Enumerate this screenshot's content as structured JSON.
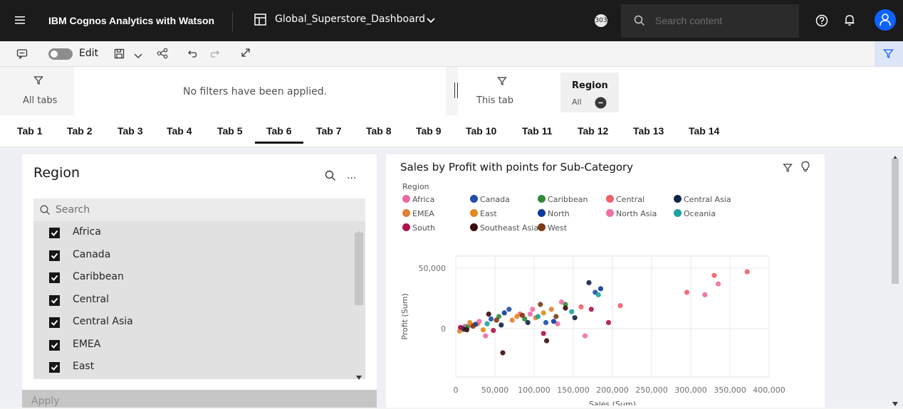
{
  "app": {
    "title": "IBM Cognos Analytics with Watson",
    "dashboard_name": "Global_Superstore_Dashboard",
    "notification_badge": "303",
    "search_placeholder": "Search content"
  },
  "toolbar": {
    "edit_label": "Edit"
  },
  "filters": {
    "all_tabs_label": "All tabs",
    "no_filters_text": "No filters have been applied.",
    "this_tab_label": "This tab",
    "region_chip": {
      "title": "Region",
      "value": "All"
    }
  },
  "tabs": [
    "Tab 1",
    "Tab 2",
    "Tab 3",
    "Tab 4",
    "Tab 5",
    "Tab 6",
    "Tab 7",
    "Tab 8",
    "Tab 9",
    "Tab 10",
    "Tab 11",
    "Tab 12",
    "Tab 13",
    "Tab 14"
  ],
  "active_tab": "Tab 6",
  "region_panel": {
    "title": "Region",
    "search_placeholder": "Search",
    "items": [
      {
        "label": "Africa",
        "checked": true
      },
      {
        "label": "Canada",
        "checked": true
      },
      {
        "label": "Caribbean",
        "checked": true
      },
      {
        "label": "Central",
        "checked": true
      },
      {
        "label": "Central Asia",
        "checked": true
      },
      {
        "label": "EMEA",
        "checked": true
      },
      {
        "label": "East",
        "checked": true
      }
    ],
    "apply_label": "Apply"
  },
  "chart_data": {
    "type": "scatter",
    "title": "Sales by Profit with points for Sub-Category",
    "xlabel": "Sales (Sum)",
    "ylabel": "Profit (Sum)",
    "legend_title": "Region",
    "xlim": [
      0,
      400000
    ],
    "ylim": [
      -40000,
      60000
    ],
    "xticks": [
      "0",
      "50,000",
      "100,000",
      "150,000",
      "200,000",
      "250,000",
      "300,000",
      "350,000",
      "400,000"
    ],
    "yticks": [
      "0",
      "50,000"
    ],
    "grid": true,
    "series": [
      {
        "name": "Africa",
        "color": "#e96aa4",
        "points": [
          [
            12000,
            2000
          ],
          [
            38000,
            -6000
          ],
          [
            95000,
            12000
          ],
          [
            130000,
            4000
          ],
          [
            318000,
            28000
          ]
        ]
      },
      {
        "name": "Canada",
        "color": "#1f4fa6",
        "points": [
          [
            8000,
            500
          ],
          [
            45000,
            8000
          ],
          [
            68000,
            16000
          ],
          [
            115000,
            5000
          ],
          [
            178000,
            30000
          ]
        ]
      },
      {
        "name": "Caribbean",
        "color": "#2e8b3a",
        "points": [
          [
            15000,
            1500
          ],
          [
            55000,
            10000
          ],
          [
            88000,
            8000
          ],
          [
            140000,
            20000
          ]
        ]
      },
      {
        "name": "Central",
        "color": "#ee5f6b",
        "points": [
          [
            20000,
            3000
          ],
          [
            82000,
            12000
          ],
          [
            160000,
            18000
          ],
          [
            210000,
            19000
          ],
          [
            295000,
            30000
          ],
          [
            330000,
            44000
          ],
          [
            372000,
            47000
          ]
        ]
      },
      {
        "name": "Central Asia",
        "color": "#0f2546",
        "points": [
          [
            10000,
            -500
          ],
          [
            58000,
            3000
          ],
          [
            92000,
            5000
          ],
          [
            152000,
            9000
          ],
          [
            170000,
            38000
          ]
        ]
      },
      {
        "name": "EMEA",
        "color": "#e08034",
        "points": [
          [
            5000,
            -2000
          ],
          [
            28000,
            4000
          ],
          [
            72000,
            7000
          ],
          [
            102000,
            9000
          ],
          [
            122000,
            16000
          ]
        ]
      },
      {
        "name": "East",
        "color": "#e08a1e",
        "points": [
          [
            18000,
            5000
          ],
          [
            35000,
            -1000
          ],
          [
            78000,
            10000
          ],
          [
            112000,
            13000
          ]
        ]
      },
      {
        "name": "North",
        "color": "#0c3aa0",
        "points": [
          [
            25000,
            3500
          ],
          [
            62000,
            13000
          ],
          [
            125000,
            6000
          ],
          [
            185000,
            33000
          ]
        ]
      },
      {
        "name": "North Asia",
        "color": "#ee6fa2",
        "points": [
          [
            30000,
            6000
          ],
          [
            98000,
            16000
          ],
          [
            135000,
            22000
          ],
          [
            165000,
            -6000
          ],
          [
            335000,
            37000
          ]
        ]
      },
      {
        "name": "Oceania",
        "color": "#1aa3a0",
        "points": [
          [
            40000,
            4000
          ],
          [
            105000,
            10000
          ],
          [
            148000,
            14000
          ],
          [
            182000,
            28000
          ]
        ]
      },
      {
        "name": "South",
        "color": "#b0124e",
        "points": [
          [
            6000,
            1000
          ],
          [
            48000,
            -1500
          ],
          [
            112000,
            -4000
          ],
          [
            173000,
            16000
          ],
          [
            195000,
            5000
          ]
        ]
      },
      {
        "name": "Southeast Asia",
        "color": "#3a0a0a",
        "points": [
          [
            14000,
            -1000
          ],
          [
            42000,
            12000
          ],
          [
            60000,
            -20000
          ],
          [
            116000,
            -10000
          ],
          [
            140000,
            17000
          ]
        ]
      },
      {
        "name": "West",
        "color": "#7a3a15",
        "points": [
          [
            22000,
            2000
          ],
          [
            52000,
            7000
          ],
          [
            85000,
            11000
          ],
          [
            108000,
            20000
          ],
          [
            128000,
            10000
          ]
        ]
      }
    ]
  }
}
